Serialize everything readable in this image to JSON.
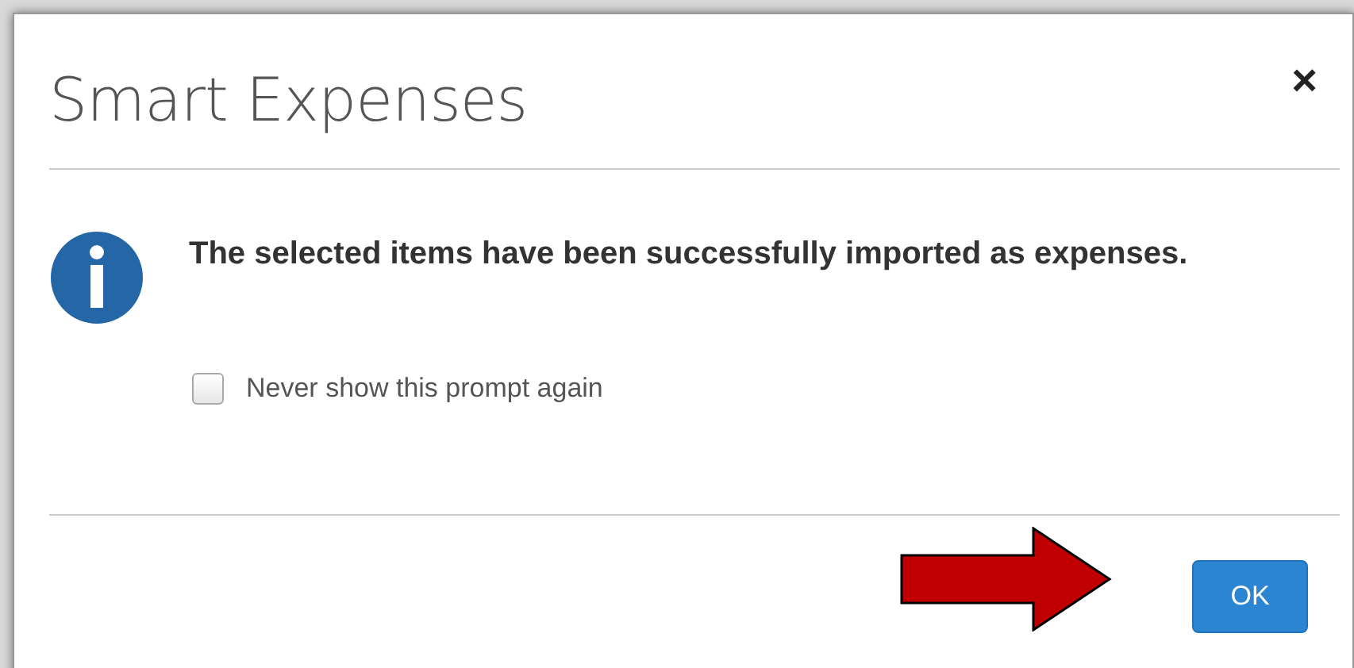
{
  "dialog": {
    "title": "Smart Expenses",
    "close": "×",
    "message": "The selected items have been successfully imported as expenses.",
    "checkbox": {
      "label": "Never show this prompt again",
      "checked": false
    },
    "buttons": [
      "OK"
    ]
  }
}
